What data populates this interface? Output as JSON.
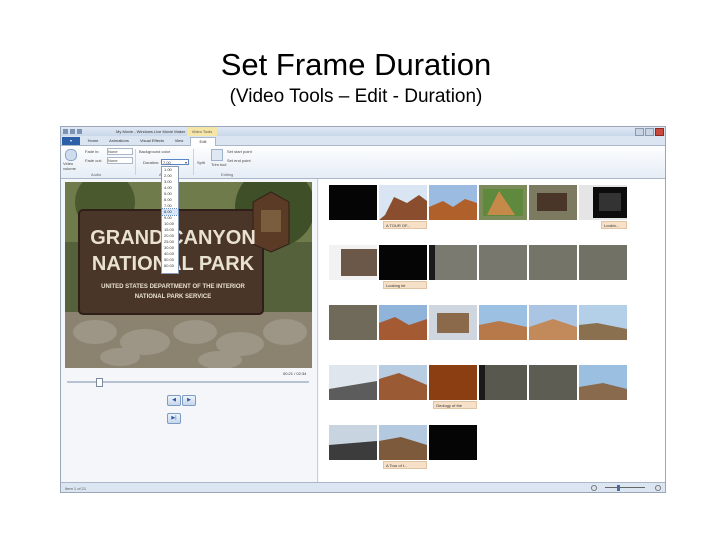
{
  "slide": {
    "title": "Set Frame Duration",
    "subtitle": "(Video Tools – Edit - Duration)"
  },
  "window": {
    "title": "My Movie - Windows Live Movie Maker",
    "context_tab": "Video Tools",
    "tabs": [
      "Home",
      "Animations",
      "Visual Effects",
      "View",
      "Edit"
    ],
    "file_tab": "▾"
  },
  "ribbon": {
    "video_volume": "Video volume",
    "fade_in": "Fade in:",
    "fade_in_value": "None",
    "fade_out": "Fade out:",
    "fade_out_value": "None",
    "background_color": "Background color",
    "duration_label": "Duration:",
    "duration_value": "7.00",
    "split": "Split",
    "trim_tool": "Trim tool",
    "set_start": "Set start point",
    "set_end": "Set end point",
    "group_audio": "Audio",
    "group_editing": "Editing",
    "group_adjust": "Adjust"
  },
  "duration_options": [
    "1.00",
    "2.00",
    "3.00",
    "4.00",
    "5.00",
    "6.00",
    "7.00",
    "8.00",
    "9.00",
    "10.00",
    "15.00",
    "20.00",
    "25.00",
    "30.00",
    "40.00",
    "50.00",
    "60.00"
  ],
  "duration_selected": 7,
  "preview": {
    "sign_line1": "GRAND CANYON",
    "sign_line2": "NATIONAL PARK",
    "sign_line3": "UNITED STATES DEPARTMENT OF THE INTERIOR",
    "sign_line4": "NATIONAL PARK SERVICE",
    "time": "00:21 / 02:34",
    "seek_position": 0.14
  },
  "playback": {
    "prev": "◀",
    "play": "▶",
    "next": "▶|"
  },
  "storyboard": {
    "captions": [
      "A TOUR OF...",
      "Lookin...",
      "Looking int",
      "Geology of the",
      "A Tour of t..."
    ]
  },
  "status": {
    "text": "Item 1 of 21"
  },
  "zoom": {
    "minus": "–",
    "plus": "+"
  },
  "colors": {
    "ribbon_accent": "#2c5fa8",
    "context_tab": "#f6e6a6",
    "caption_bg": "#f6e0c8"
  }
}
